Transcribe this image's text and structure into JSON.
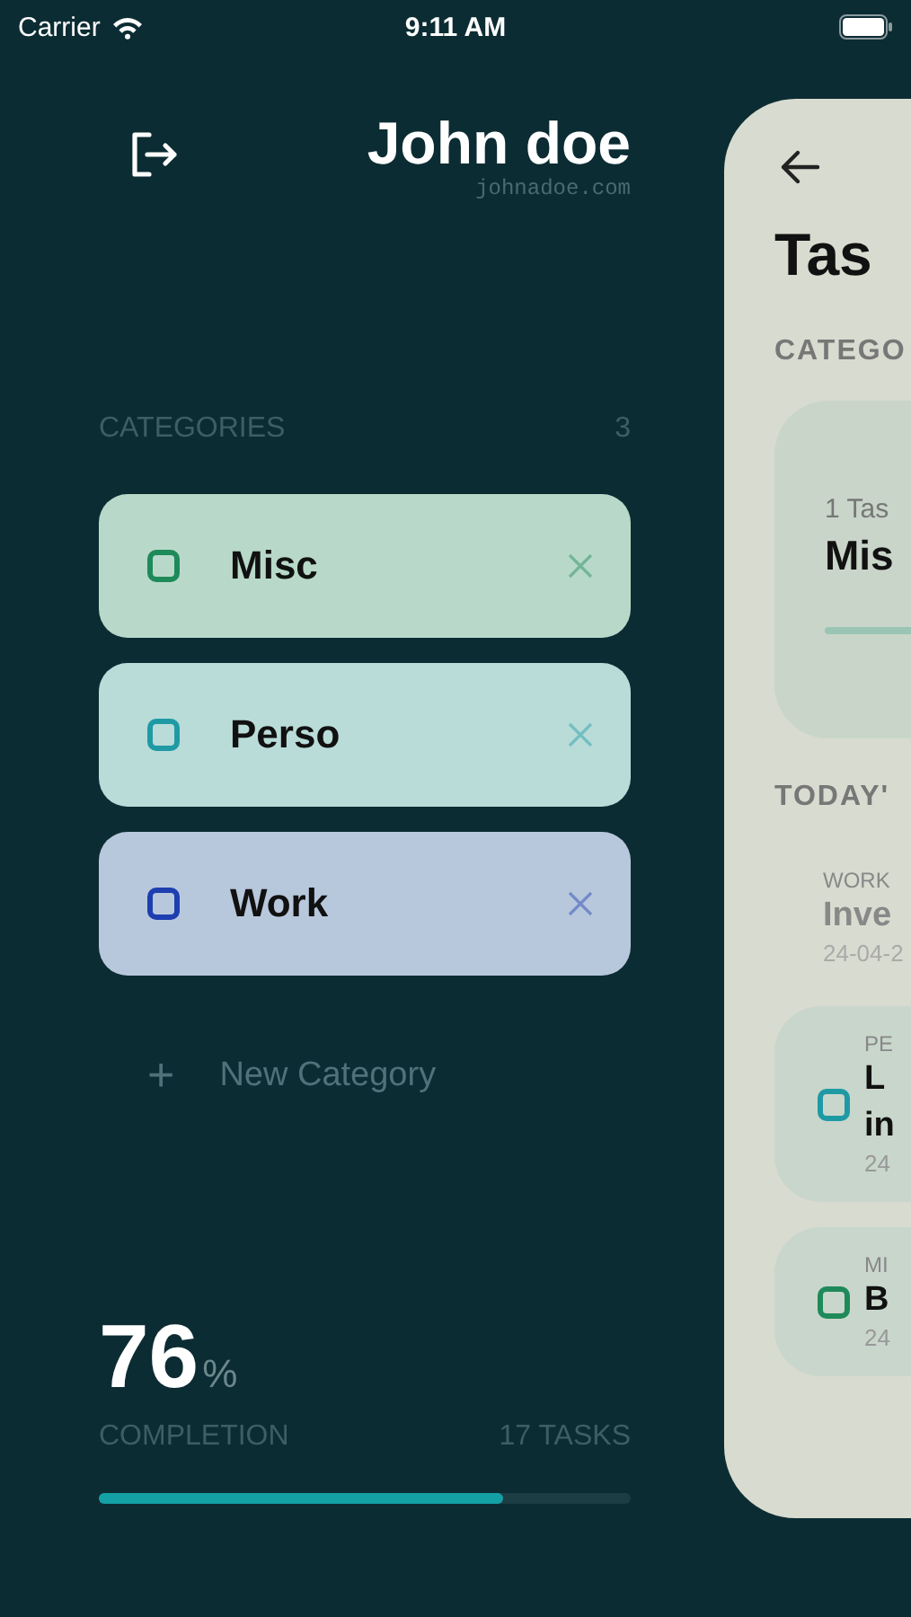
{
  "status_bar": {
    "carrier": "Carrier",
    "time": "9:11 AM"
  },
  "profile": {
    "name": "John doe",
    "email": "johnadoe.com"
  },
  "categories_header": {
    "label": "CATEGORIES",
    "count": "3"
  },
  "categories": [
    {
      "name": "Misc",
      "color": "#1e8a5a"
    },
    {
      "name": "Perso",
      "color": "#1f9aa5"
    },
    {
      "name": "Work",
      "color": "#1e3fb0"
    }
  ],
  "new_category": {
    "icon": "+",
    "label": "New Category"
  },
  "completion": {
    "percent": "76",
    "unit": "%",
    "label": "COMPLETION",
    "tasks": "17 TASKS",
    "level": 0.76
  },
  "panel": {
    "title": "Tas",
    "categories_label": "CATEGO",
    "category_card": {
      "count": "1 Tas",
      "name": "Mis"
    },
    "today_label": "TODAY'",
    "tasks": [
      {
        "category": "WORK",
        "title_lines": [
          "Inve"
        ],
        "date": "24-04-2",
        "done": true
      },
      {
        "category": "PE",
        "title_lines": [
          "L",
          "in"
        ],
        "date": "24",
        "done": false,
        "color": "#1f9aa5"
      },
      {
        "category": "MI",
        "title_lines": [
          "B"
        ],
        "date": "24",
        "done": false,
        "color": "#1e8a5a"
      }
    ]
  }
}
